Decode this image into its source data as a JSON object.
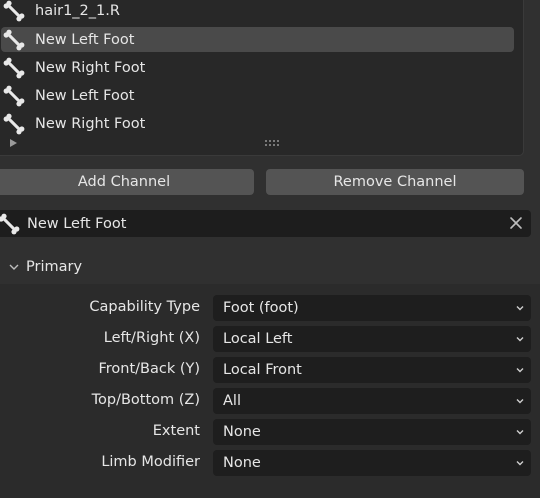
{
  "channel_list": {
    "items": [
      {
        "label": "hair1_2_1.R",
        "selected": false
      },
      {
        "label": "New Left Foot",
        "selected": true
      },
      {
        "label": "New Right Foot",
        "selected": false
      },
      {
        "label": "New Left Foot",
        "selected": false
      },
      {
        "label": "New Right Foot",
        "selected": false
      }
    ]
  },
  "buttons": {
    "add_label": "Add Channel",
    "remove_label": "Remove Channel"
  },
  "name_field": {
    "value": "New Left Foot"
  },
  "section": {
    "title": "Primary",
    "expanded": true
  },
  "properties": [
    {
      "label": "Capability Type",
      "value": "Foot (foot)"
    },
    {
      "label": "Left/Right (X)",
      "value": "Local Left"
    },
    {
      "label": "Front/Back (Y)",
      "value": "Local Front"
    },
    {
      "label": "Top/Bottom (Z)",
      "value": "All"
    },
    {
      "label": "Extent",
      "value": "None"
    },
    {
      "label": "Limb Modifier",
      "value": "None"
    }
  ],
  "icons": {
    "list_item": "bone-icon",
    "expander": "disclosure-triangle-icon",
    "grip": "resize-grip-icon",
    "clear": "close-icon",
    "section": "chevron-down-icon",
    "dropdown": "chevron-down-icon"
  },
  "colors": {
    "panel_bg": "#303030",
    "list_bg": "#282828",
    "selected_row": "#4a4a4a",
    "button_bg": "#545454",
    "field_bg": "#1e1e1e",
    "text": "#e6e6e6"
  }
}
